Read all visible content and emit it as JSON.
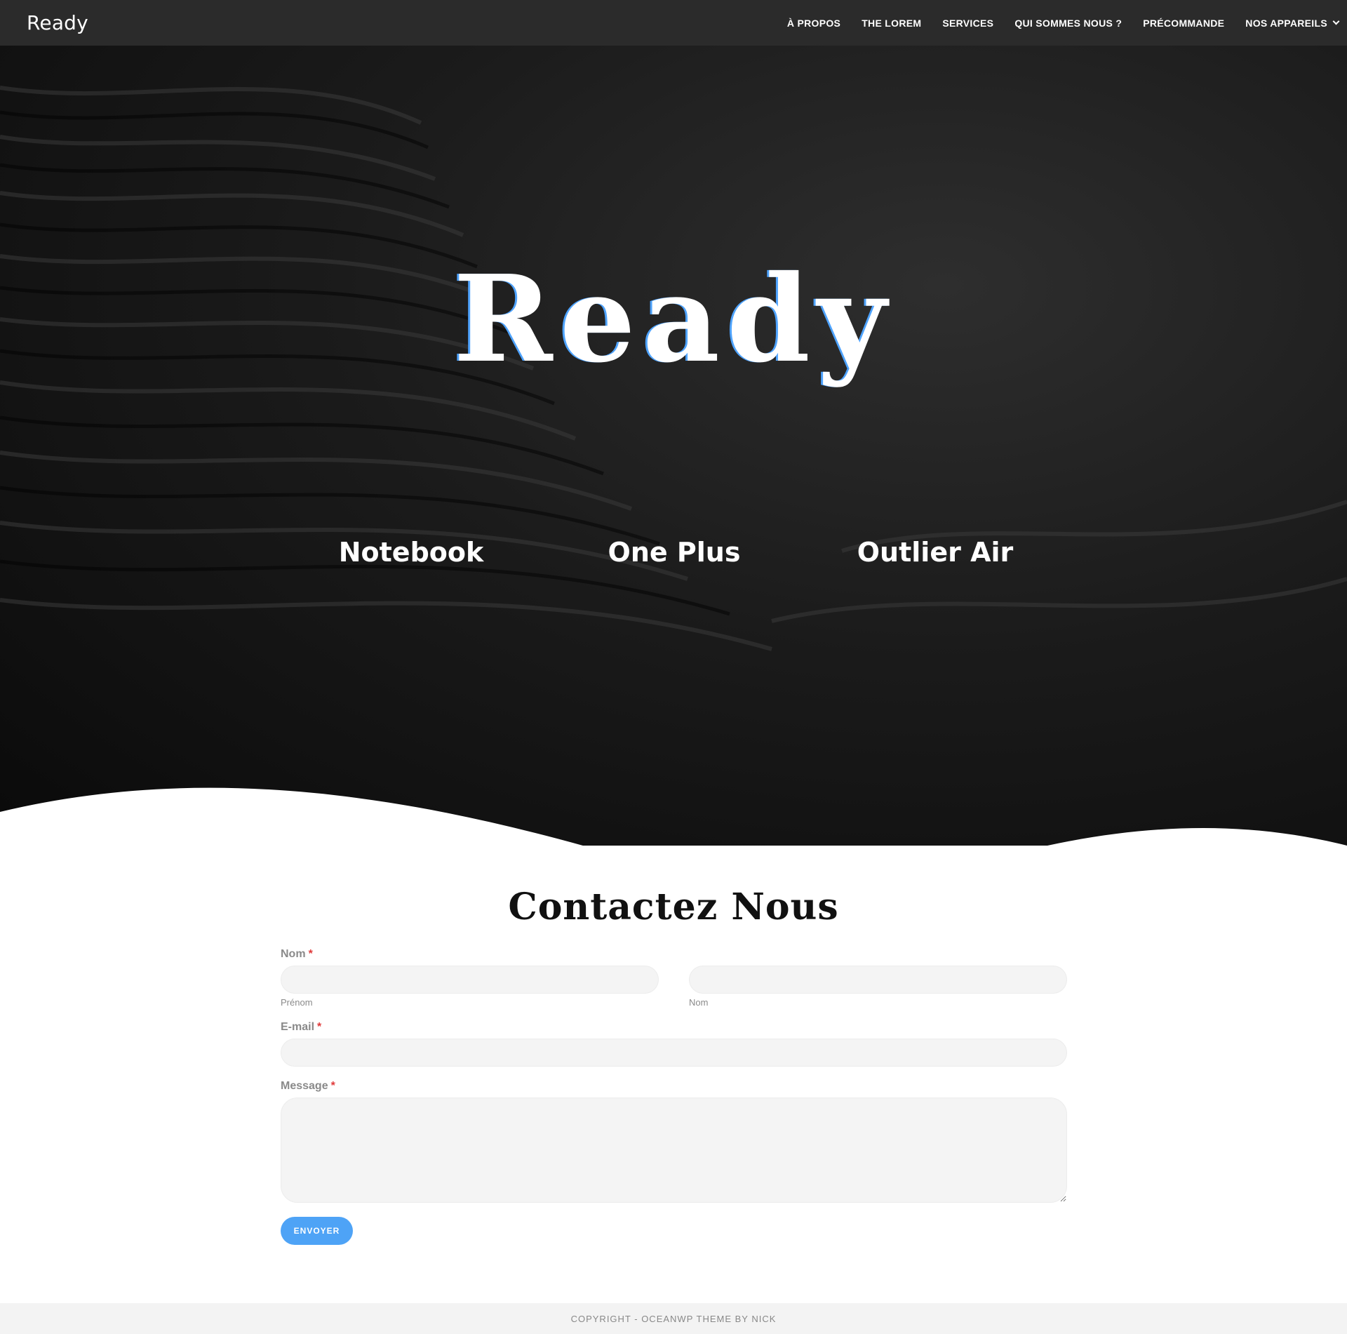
{
  "header": {
    "logo": "Ready",
    "nav": [
      {
        "label": "À PROPOS"
      },
      {
        "label": "THE LOREM"
      },
      {
        "label": "SERVICES"
      },
      {
        "label": "QUI SOMMES NOUS ?"
      },
      {
        "label": "PRÉCOMMANDE"
      },
      {
        "label": "NOS APPAREILS",
        "has_dropdown": true
      }
    ]
  },
  "hero": {
    "title": "Ready",
    "products": [
      "Notebook",
      "One Plus",
      "Outlier Air"
    ]
  },
  "contact": {
    "title": "Contactez Nous",
    "name_label": "Nom",
    "required_mark": "*",
    "first_name_sub": "Prénom",
    "last_name_sub": "Nom",
    "email_label": "E-mail",
    "message_label": "Message",
    "submit_label": "ENVOYER"
  },
  "footer": {
    "text": "COPYRIGHT - OCEANWP THEME BY NICK"
  },
  "colors": {
    "header_bg": "#2b2b2b",
    "accent": "#4ea3f6",
    "required": "#e03a3a"
  }
}
